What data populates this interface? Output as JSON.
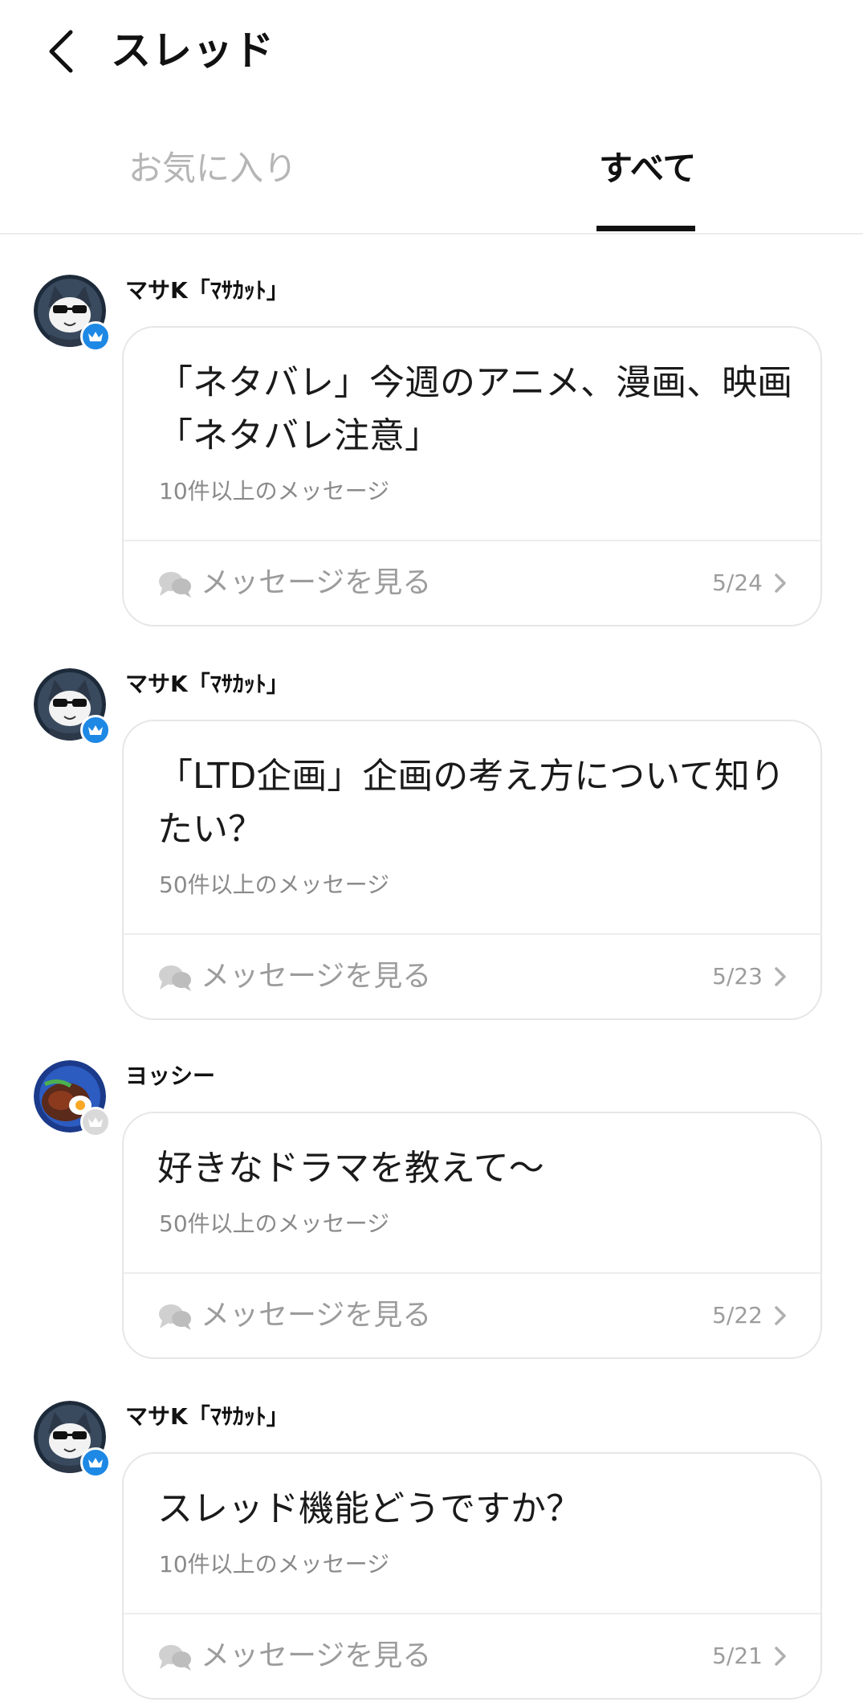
{
  "header": {
    "title": "スレッド",
    "back_icon": "chevron-left-icon"
  },
  "tabs": [
    {
      "label": "お気に入り",
      "active": false
    },
    {
      "label": "すべて",
      "active": true
    }
  ],
  "threads": [
    {
      "author": "マサK「ﾏｻｶｯﾄ」",
      "avatar": "cat-avatar",
      "badge_color": "#1e88e5",
      "title_lines": [
        "「ネタバレ」今週のアニメ、漫画、映画",
        "「ネタバレ注意」"
      ],
      "count": "10件以上のメッセージ",
      "action": "メッセージを見る",
      "date": "5/24"
    },
    {
      "author": "マサK「ﾏｻｶｯﾄ」",
      "avatar": "cat-avatar",
      "badge_color": "#1e88e5",
      "title_lines": [
        "「LTD企画」企画の考え方について知り",
        "たい？"
      ],
      "count": "50件以上のメッセージ",
      "action": "メッセージを見る",
      "date": "5/23"
    },
    {
      "author": "ヨッシー",
      "avatar": "food-avatar",
      "badge_color": "#d9d9d9",
      "title_lines": [
        "好きなドラマを教えて～"
      ],
      "count": "50件以上のメッセージ",
      "action": "メッセージを見る",
      "date": "5/22"
    },
    {
      "author": "マサK「ﾏｻｶｯﾄ」",
      "avatar": "cat-avatar",
      "badge_color": "#1e88e5",
      "title_lines": [
        "スレッド機能どうですか？"
      ],
      "count": "10件以上のメッセージ",
      "action": "メッセージを見る",
      "date": "5/21"
    }
  ]
}
